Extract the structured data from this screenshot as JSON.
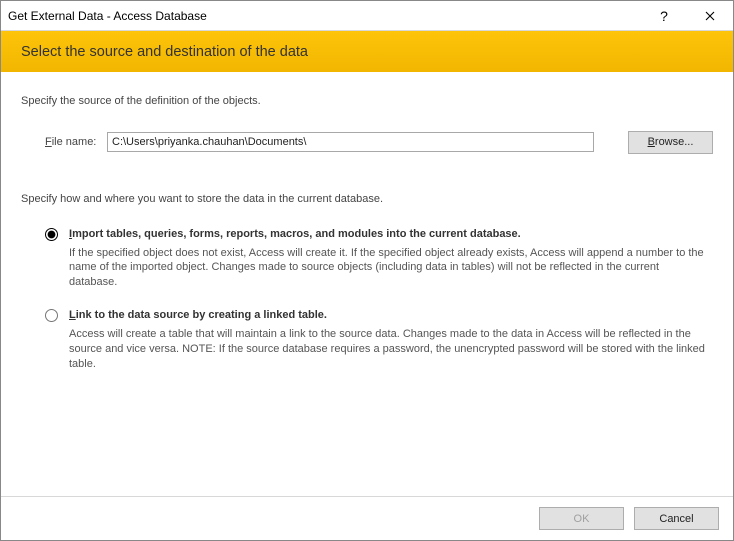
{
  "titlebar": {
    "title": "Get External Data - Access Database",
    "help": "?",
    "close": "✕"
  },
  "banner": {
    "heading": "Select the source and destination of the data"
  },
  "source_label": "Specify the source of the definition of the objects.",
  "file": {
    "label_prefix": "F",
    "label_rest": "ile name:",
    "value": "C:\\Users\\priyanka.chauhan\\Documents\\",
    "browse_prefix": "B",
    "browse_rest": "rowse..."
  },
  "store_label": "Specify how and where you want to store the data in the current database.",
  "options": [
    {
      "selected": true,
      "title_prefix": "I",
      "title_rest": "mport tables, queries, forms, reports, macros, and modules into the current database.",
      "desc": "If the specified object does not exist, Access will create it. If the specified object already exists, Access will append a number to the name of the imported object. Changes made to source objects (including data in tables) will not be reflected in the current database."
    },
    {
      "selected": false,
      "title_prefix": "L",
      "title_rest": "ink to the data source by creating a linked table.",
      "desc": "Access will create a table that will maintain a link to the source data. Changes made to the data in Access will be reflected in the source and vice versa. NOTE:  If the source database requires a password, the unencrypted password will be stored with the linked table."
    }
  ],
  "footer": {
    "ok": "OK",
    "cancel": "Cancel"
  }
}
